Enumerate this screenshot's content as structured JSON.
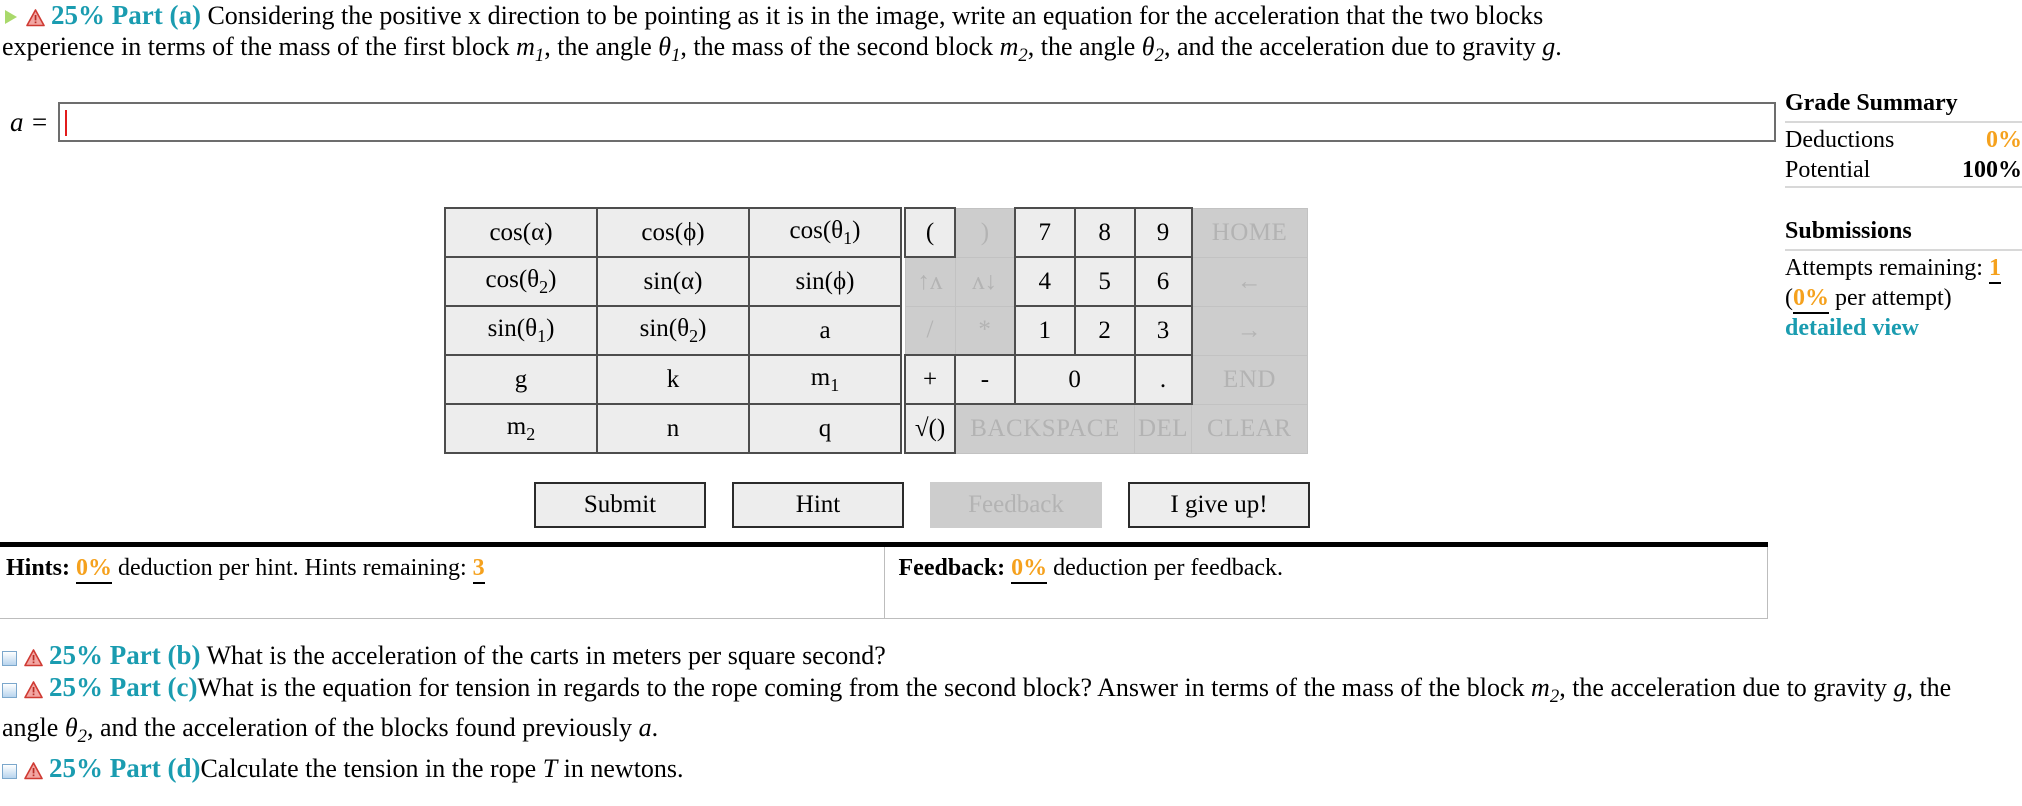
{
  "part_a": {
    "percent_label": "25% Part (a)",
    "icons": {
      "expander": "play-triangle-icon",
      "warning": "warning-triangle-icon"
    },
    "text_1": "Considering the positive x direction to be pointing as it is in the image, write an equation for the acceleration that the two blocks",
    "text_2_a": "experience in terms of the mass of the first block ",
    "m1": "m",
    "m1_sub": "1",
    "text_2_b": ", the angle ",
    "theta": "θ",
    "theta1_sub": "1",
    "text_2_c": ", the mass of the second block ",
    "m2": "m",
    "m2_sub": "2",
    "text_2_d": ", the angle ",
    "theta2_sub": "2",
    "text_2_e": ", and the acceleration due to gravity ",
    "g": "g",
    "text_2_f": "."
  },
  "answer": {
    "label": "a =",
    "value": "",
    "placeholder": ""
  },
  "grade_summary": {
    "title": "Grade Summary",
    "rows": [
      {
        "label": "Deductions",
        "value": "0%"
      },
      {
        "label": "Potential",
        "value": "100%"
      }
    ]
  },
  "submissions": {
    "title": "Submissions",
    "attempts_label": "Attempts remaining:",
    "attempts_value": "1",
    "per_attempt_open": "(",
    "per_attempt_pct": "0%",
    "per_attempt_close": " per attempt)",
    "detailed_view": "detailed view"
  },
  "calculator": {
    "variable_keys": [
      [
        "cos(α)",
        "cos(ϕ)",
        "COS_THETA1"
      ],
      [
        "COS_THETA2",
        "sin(α)",
        "sin(ϕ)"
      ],
      [
        "SIN_THETA1",
        "SIN_THETA2",
        "a"
      ],
      [
        "g",
        "k",
        "M_1"
      ],
      [
        "M_2",
        "n",
        "q"
      ]
    ],
    "variable_keys_display": {
      "cos_theta1": {
        "pre": "cos(θ",
        "sub": "1",
        "post": ")"
      },
      "cos_theta2": {
        "pre": "cos(θ",
        "sub": "2",
        "post": ")"
      },
      "sin_theta1": {
        "pre": "sin(θ",
        "sub": "1",
        "post": ")"
      },
      "sin_theta2": {
        "pre": "sin(θ",
        "sub": "2",
        "post": ")"
      },
      "m_1": {
        "pre": "m",
        "sub": "1",
        "post": ""
      },
      "m_2": {
        "pre": "m",
        "sub": "2",
        "post": ""
      }
    },
    "numeric_keys": {
      "open_paren": "(",
      "close_paren": ")",
      "seven": "7",
      "eight": "8",
      "nine": "9",
      "home": "HOME",
      "sup_arrow": "↑ʌ",
      "sub_arrow": "ʌ↓",
      "four": "4",
      "five": "5",
      "six": "6",
      "left_arrow": "←",
      "divide": "/",
      "times": "*",
      "one": "1",
      "two": "2",
      "three": "3",
      "right_arrow": "→",
      "plus": "+",
      "minus": "-",
      "zero": "0",
      "dot": ".",
      "end": "END",
      "sqrt": "√()",
      "backspace": "BACKSPACE",
      "del": "DEL",
      "clear": "CLEAR"
    },
    "disabled_keys": [
      ")",
      "↑ʌ",
      "ʌ↓",
      "/",
      "*",
      "HOME",
      "←",
      "→",
      "END",
      "BACKSPACE",
      "DEL",
      "CLEAR"
    ]
  },
  "actions": {
    "submit": "Submit",
    "hint": "Hint",
    "feedback": "Feedback",
    "give_up": "I give up!",
    "feedback_disabled": true
  },
  "hints_bar": {
    "hints_label": "Hints:",
    "hints_pct": "0%",
    "hints_text": "deduction per hint. Hints remaining:",
    "hints_remaining": "3",
    "feedback_label": "Feedback:",
    "feedback_pct": "0%",
    "feedback_text": "deduction per feedback."
  },
  "parts": [
    {
      "id": "part-b",
      "percent_label": "25% Part (b)",
      "text": "What is the acceleration of the carts in meters per square second?"
    },
    {
      "id": "part-c",
      "percent_label": "25% Part (c)",
      "text_a": "What is the equation for tension in regards to the rope coming from the second block? Answer in terms of the mass of the block ",
      "m2": "m",
      "m2_sub": "2",
      "text_b": ", the",
      "text_c": "acceleration due to gravity ",
      "g": "g",
      "text_d": ", the angle ",
      "theta": "θ",
      "theta2_sub": "2",
      "text_e": ", and the acceleration of the blocks found previously ",
      "a": "a",
      "text_f": "."
    },
    {
      "id": "part-d",
      "percent_label": "25% Part (d)",
      "text_a": "Calculate the tension in the rope ",
      "T": "T",
      "text_b": " in newtons."
    }
  ],
  "colors": {
    "accent_teal": "#1a9cb0",
    "accent_orange": "#f5a11d",
    "warning_red": "#d9534f",
    "key_bg": "#ededed",
    "key_disabled_bg": "#cdcdcd"
  }
}
